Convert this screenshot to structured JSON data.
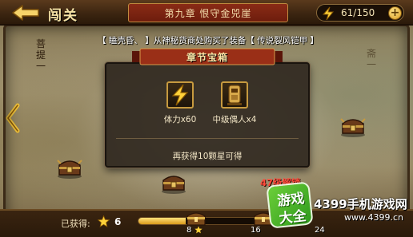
{
  "header": {
    "back_icon": "back-arrow-icon",
    "title": "闯关",
    "chapter": "第九章 恨守金兕崖",
    "energy_icon": "lightning-icon",
    "energy": "61/150",
    "plus_icon": "plus-icon"
  },
  "notice": "【 瞌壳昏、 】从神秘货商处购买了装备【 传说裂风铠甲 】",
  "map": {
    "side_label_left": "菩提一",
    "side_label_right": "斋一",
    "left_arrow_icon": "chevron-left-icon"
  },
  "modal": {
    "title": "章节宝箱",
    "rewards": [
      {
        "icon": "lightning-icon",
        "label": "体力x60"
      },
      {
        "icon": "puppet-icon",
        "label": "中级偶人x4"
      }
    ],
    "hint": "再获得10颗星可得"
  },
  "unlock_note": "47级解锁",
  "progress": {
    "label": "已获得:",
    "star_icon": "star-icon",
    "stars": "6",
    "fraction": 0.375,
    "milestones": [
      "8",
      "16",
      "24"
    ]
  },
  "watermark": {
    "badge_line1": "游戏",
    "badge_line2": "大全",
    "title": "4399手机游戏网",
    "url": "www.4399.cn"
  },
  "colors": {
    "accent_gold": "#f6e3a6",
    "ribbon_red": "#8a2b16",
    "unlock_red": "#ff4a3a",
    "progress_fill": "#d99a1a"
  }
}
